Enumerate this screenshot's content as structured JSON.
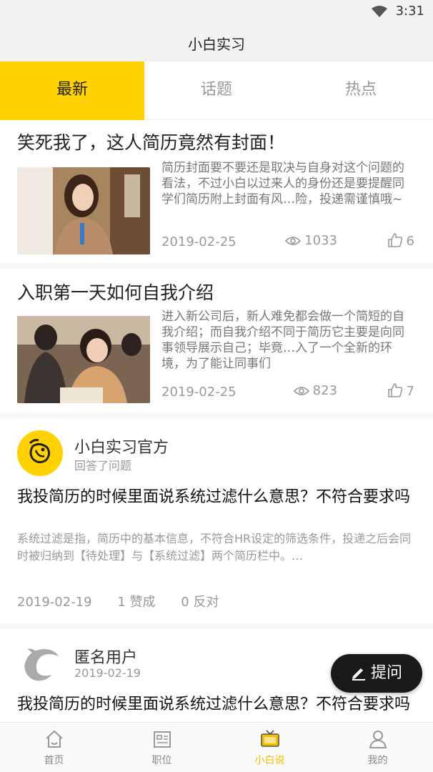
{
  "status_bar": {
    "time": "3:31"
  },
  "app": {
    "title": "小白实习"
  },
  "tabs": [
    {
      "label": "最新",
      "active": true
    },
    {
      "label": "话题",
      "active": false
    },
    {
      "label": "热点",
      "active": false
    }
  ],
  "articles": [
    {
      "title": "笑死我了，这人简历竟然有封面！",
      "excerpt": "简历封面要不要还是取决与自身对这个问题的看法，不过小白以过来人的身份还是要提醒同学们简历附上封面有风…险，投递需谨慎哦~",
      "date": "2019-02-25",
      "views": "1033",
      "likes": "6"
    },
    {
      "title": "入职第一天如何自我介绍",
      "excerpt": "进入新公司后，新人难免都会做一个简短的自我介绍；而自我介绍不同于简历它主要是向同事领导展示自己；毕竟…入了一个全新的环境，为了能让同事们",
      "date": "2019-02-25",
      "views": "823",
      "likes": "7"
    }
  ],
  "answers": [
    {
      "user": "小白实习官方",
      "subtitle": "回答了问题",
      "question": "我投简历的时候里面说系统过滤什么意思？不符合要求吗",
      "answer": "系统过滤是指，简历中的基本信息，不符合HR设定的筛选条件，投递之后会同时被归纳到【待处理】与【系统过滤】两个简历栏中。…",
      "date": "2019-02-19",
      "agree": "1 赞成",
      "oppose": "0 反对"
    },
    {
      "user": "匿名用户",
      "subtitle": "2019-02-19",
      "question": "我投简历的时候里面说系统过滤什么意思？不符合要求吗"
    }
  ],
  "ask_button": {
    "label": "提问"
  },
  "bottom_nav": [
    {
      "label": "首页",
      "icon": "home-icon",
      "active": false
    },
    {
      "label": "职位",
      "icon": "briefcase-icon",
      "active": false
    },
    {
      "label": "小白说",
      "icon": "tv-icon",
      "active": true
    },
    {
      "label": "我的",
      "icon": "user-icon",
      "active": false
    }
  ],
  "colors": {
    "accent": "#ffd200",
    "active_nav": "#f5bf00",
    "muted": "#999999"
  }
}
